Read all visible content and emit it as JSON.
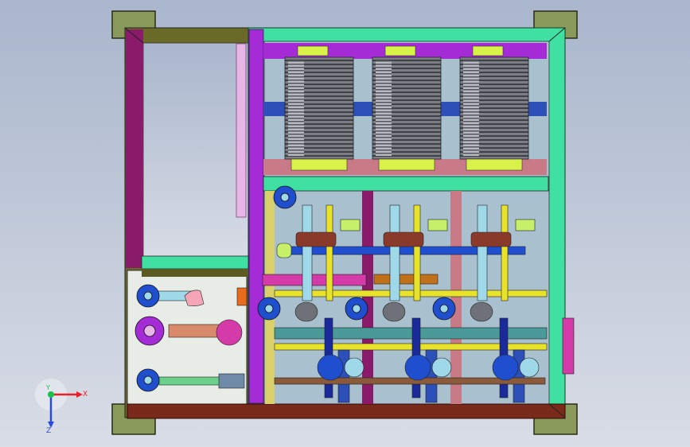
{
  "viewport": {
    "background_top": "#a9b6cc",
    "background_bottom": "#d9dde6"
  },
  "triad": {
    "x_label": "X",
    "y_label": "Y",
    "z_label": "Z",
    "x_color": "#e8202a",
    "y_color": "#19c24a",
    "z_color": "#2a4bd8"
  },
  "model": {
    "icons": [
      "feet-plates",
      "skid-frame",
      "filter-stacks",
      "pump-manifold",
      "flange-valves",
      "pipe-runs"
    ],
    "colors": {
      "frame_green": "#3fe0a2",
      "frame_olive": "#5a5a22",
      "frame_purple": "#8a1a6a",
      "bar_violet": "#a52bd6",
      "bar_blue": "#2c4fb8",
      "bar_rose": "#c87a86",
      "bar_brown": "#7a2a1a",
      "filter_gray": "#6f7178",
      "filter_lime": "#d9f24a",
      "flange_blue": "#1f4fcf",
      "pipe_cyan": "#9fd8e8",
      "pipe_yellow": "#e9e22a",
      "pipe_magenta": "#d43aa8",
      "pipe_orange": "#c07018",
      "pipe_teal": "#4a9a9a",
      "pipe_navy": "#1a2a9a"
    },
    "filter_stacks": [
      {
        "name": "stack-1"
      },
      {
        "name": "stack-2"
      },
      {
        "name": "stack-3"
      }
    ]
  }
}
